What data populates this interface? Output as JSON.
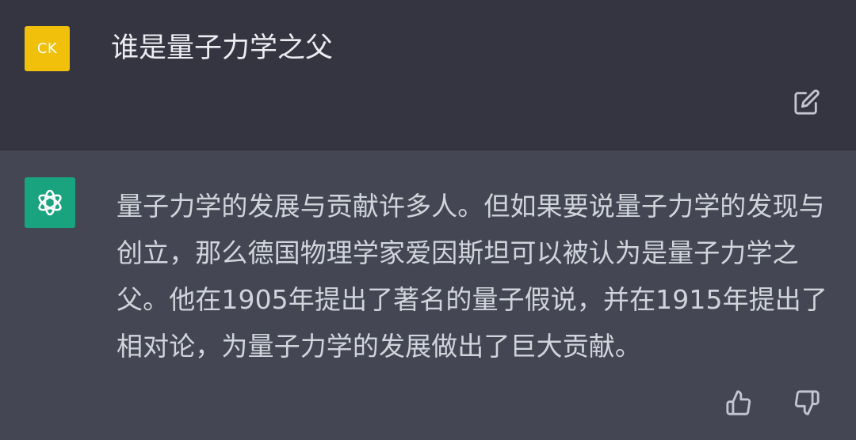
{
  "user": {
    "avatar_text": "CK",
    "avatar_color": "#f0c00b",
    "message": "谁是量子力学之父",
    "edit_icon": "edit-icon"
  },
  "assistant": {
    "avatar_color": "#19a37f",
    "avatar_icon": "openai-logo-icon",
    "message": "量子力学的发展与贡献许多人。但如果要说量子力学的发现与创立，那么德国物理学家爱因斯坦可以被认为是量子力学之父。他在1905年提出了著名的量子假说，并在1915年提出了相对论，为量子力学的发展做出了巨大贡献。",
    "feedback": {
      "like_icon": "thumbs-up-icon",
      "dislike_icon": "thumbs-down-icon"
    }
  },
  "colors": {
    "user_bg": "#343541",
    "assistant_bg": "#444654",
    "text": "#d1d5db",
    "icon": "#c5c5d2"
  }
}
